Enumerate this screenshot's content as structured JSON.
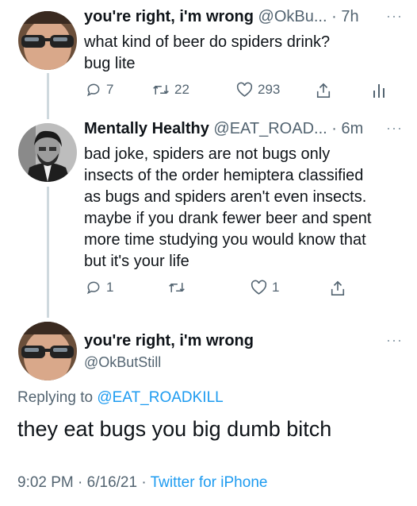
{
  "tweet1": {
    "name": "you're right, i'm wrong",
    "handle": "@OkBu...",
    "sep": "·",
    "time": "7h",
    "more": "···",
    "text": "what kind of beer do spiders drink?\nbug lite",
    "replies": "7",
    "retweets": "22",
    "likes": "293"
  },
  "tweet2": {
    "name": "Mentally Healthy",
    "handle": "@EAT_ROAD...",
    "sep": "·",
    "time": "6m",
    "more": "···",
    "text": "bad joke, spiders are not bugs only\ninsects of the order hemiptera classified\nas bugs and spiders aren't even insects.\nmaybe if you drank fewer beer and spent\nmore time studying you would know that\nbut it's your life",
    "replies": "1",
    "retweets": "",
    "likes": "1"
  },
  "main": {
    "name": "you're right, i'm wrong",
    "handle": "@OkButStill",
    "more": "···",
    "replying_prefix": "Replying to",
    "replying_to": "@EAT_ROADKILL",
    "text": "they eat bugs you big dumb bitch",
    "time": "9:02 PM",
    "sep1": "·",
    "date": "6/16/21",
    "sep2": "·",
    "source": "Twitter for iPhone"
  },
  "icons": [
    "reply-icon",
    "retweet-icon",
    "like-icon",
    "share-icon",
    "analytics-icon",
    "more-icon"
  ]
}
